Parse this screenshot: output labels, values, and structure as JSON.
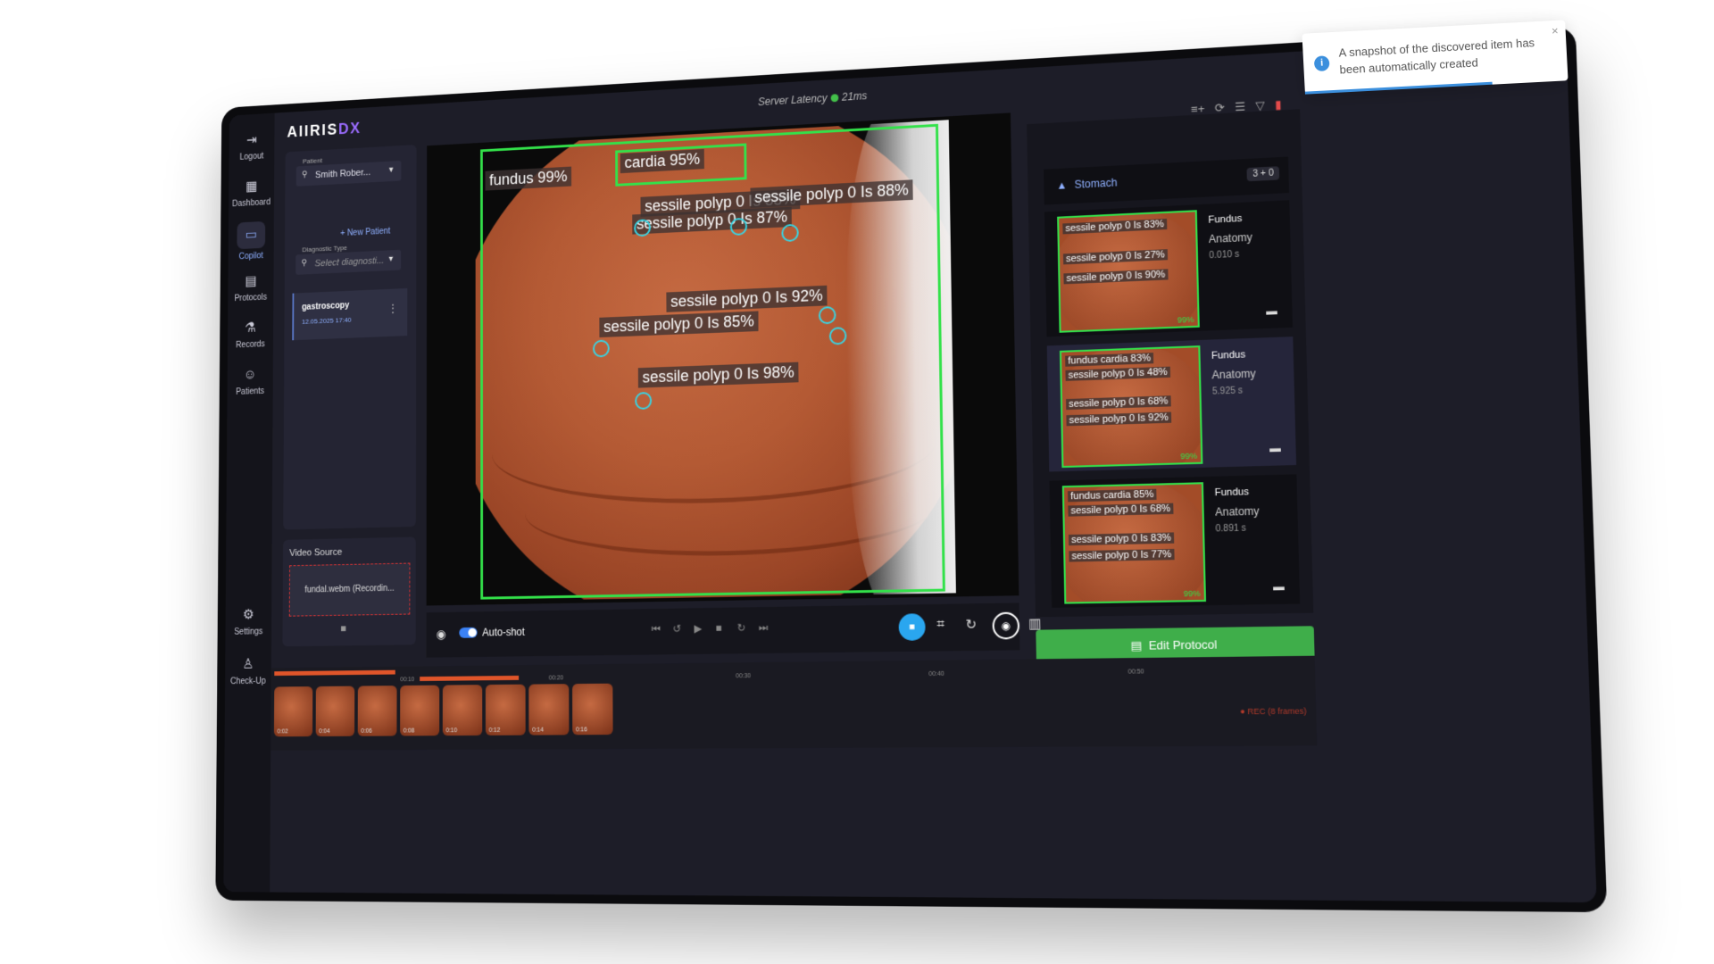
{
  "app": {
    "logo_main": "AIIRIS",
    "logo_accent": "DX",
    "latency_label": "Server Latency",
    "latency_value": "21ms"
  },
  "rail": [
    {
      "label": "Logout",
      "icon": "logout-icon"
    },
    {
      "label": "Dashboard",
      "icon": "dashboard-icon"
    },
    {
      "label": "Copilot",
      "icon": "chat-icon"
    },
    {
      "label": "Protocols",
      "icon": "document-icon"
    },
    {
      "label": "Records",
      "icon": "microscope-icon"
    },
    {
      "label": "Patients",
      "icon": "users-icon"
    },
    {
      "label": "Settings",
      "icon": "gear-icon"
    },
    {
      "label": "Check-Up",
      "icon": "person-icon"
    }
  ],
  "left": {
    "patient_caption": "Patient",
    "patient_value": "Smith Rober...",
    "new_patient": "New Patient",
    "diag_caption": "Diagnostic Type",
    "diag_placeholder": "Select diagnosti...",
    "session_title": "gastroscopy",
    "session_date": "12.05.2025 17:40",
    "video_source_title": "Video Source",
    "video_file": "fundal.webm (Recordin..."
  },
  "viewer": {
    "labels": [
      "fundus 99%",
      "cardia 95%",
      "sessile polyp 0 Is 58%",
      "sessile polyp 0 Is 88%",
      "sessile polyp 0 Is 87%",
      "sessile polyp 0 Is 92%",
      "sessile polyp 0 Is 85%",
      "sessile polyp 0 Is 98%"
    ],
    "autoshot_label": "Auto-shot"
  },
  "right": {
    "group": "Stomach",
    "group_count": "3 + 0",
    "cards": [
      {
        "region": "Fundus",
        "anatomy": "Anatomy",
        "time": "0.010 s",
        "labels": [
          "sessile polyp 0 Is 83%",
          "sessile polyp 0 Is 27%",
          "sessile polyp 0 Is 90%"
        ],
        "pct": "99%"
      },
      {
        "region": "Fundus",
        "anatomy": "Anatomy",
        "time": "5.925 s",
        "labels": [
          "fundus cardia 83%",
          "sessile polyp 0 Is 48%",
          "sessile polyp 0 Is 68%",
          "sessile polyp 0 Is 92%"
        ],
        "pct": "99%"
      },
      {
        "region": "Fundus",
        "anatomy": "Anatomy",
        "time": "0.891 s",
        "labels": [
          "fundus cardia 85%",
          "sessile polyp 0 Is 68%",
          "sessile polyp 0 Is 83%",
          "sessile polyp 0 Is 77%"
        ],
        "pct": "99%"
      }
    ],
    "edit_protocol": "Edit Protocol"
  },
  "timeline": {
    "ticks": [
      "00:10",
      "00:20",
      "00:30",
      "00:40",
      "00:50"
    ],
    "thumbs": [
      "0:02",
      "0:04",
      "0:06",
      "0:08",
      "0:10",
      "0:12",
      "0:14",
      "0:16"
    ],
    "rec": "REC (8 frames)"
  },
  "toast": {
    "message": "A snapshot of the discovered item has been automatically created"
  }
}
